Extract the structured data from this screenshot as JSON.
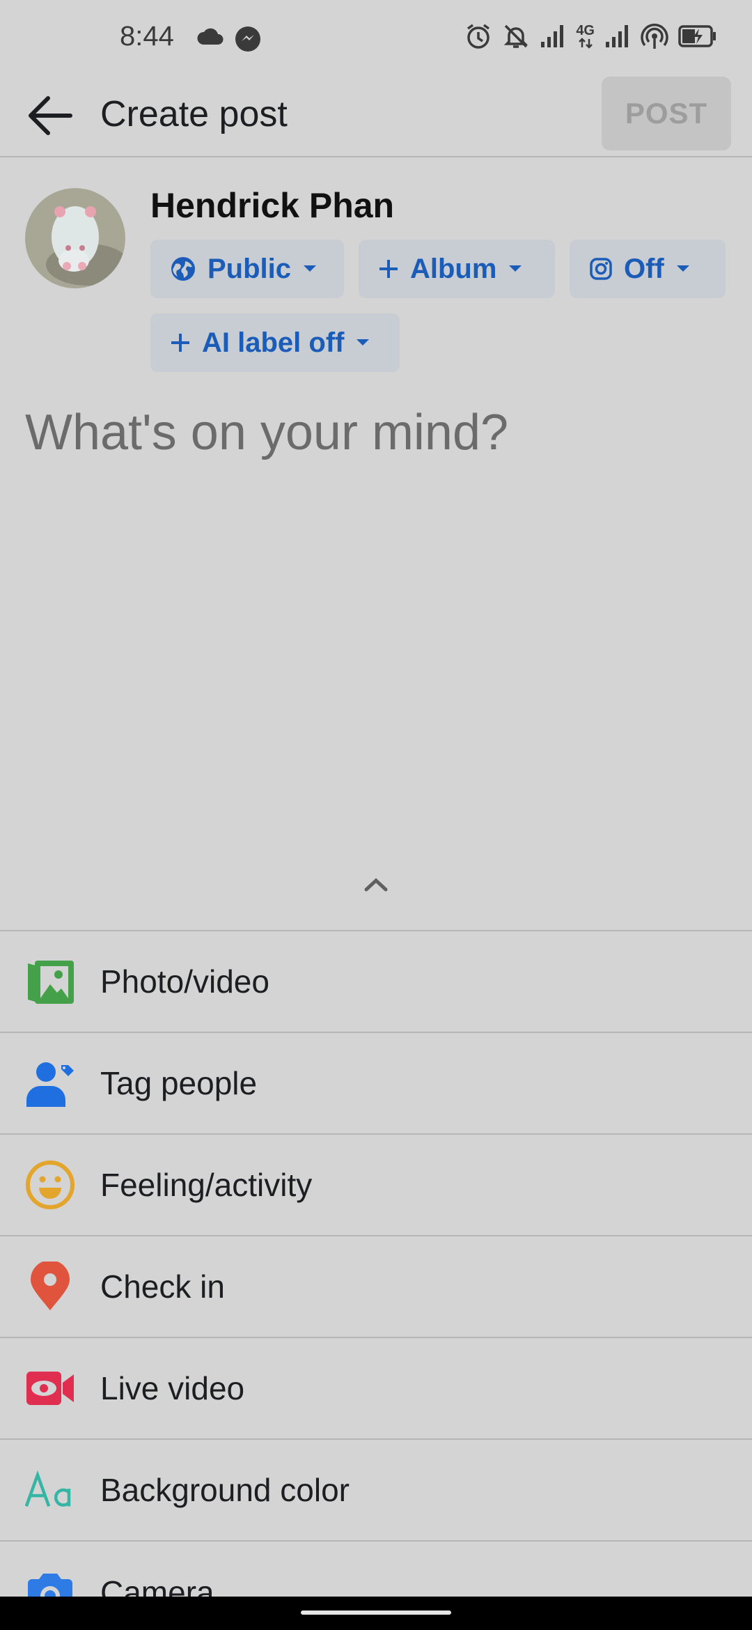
{
  "status_bar": {
    "time": "8:44",
    "network": "4G",
    "icons": [
      "cloud-icon",
      "messenger-icon",
      "alarm-icon",
      "bell-off-icon",
      "signal-icon",
      "signal-icon",
      "hotspot-icon",
      "battery-icon"
    ]
  },
  "header": {
    "title": "Create post",
    "post_label": "POST"
  },
  "user": {
    "name": "Hendrick Phan"
  },
  "chips": {
    "audience": "Public",
    "album": "Album",
    "instagram": "Off",
    "ai_label": "AI label off"
  },
  "composer": {
    "placeholder": "What's on your mind?"
  },
  "options": [
    {
      "label": "Photo/video",
      "icon": "photo-icon"
    },
    {
      "label": "Tag people",
      "icon": "tag-people-icon"
    },
    {
      "label": "Feeling/activity",
      "icon": "smiley-icon"
    },
    {
      "label": "Check in",
      "icon": "location-pin-icon"
    },
    {
      "label": "Live video",
      "icon": "live-video-icon"
    },
    {
      "label": "Background color",
      "icon": "text-aa-icon"
    },
    {
      "label": "Camera",
      "icon": "camera-icon"
    }
  ],
  "colors": {
    "background": "#d4d4d4",
    "chip_text": "#1a5cb8",
    "photo": "#45a04a",
    "tag": "#1f6fe0",
    "feeling": "#e3a52b",
    "checkin": "#e0533c",
    "live": "#df2e4f",
    "bgcolor": "#35b5a3",
    "camera": "#2f7be6"
  }
}
